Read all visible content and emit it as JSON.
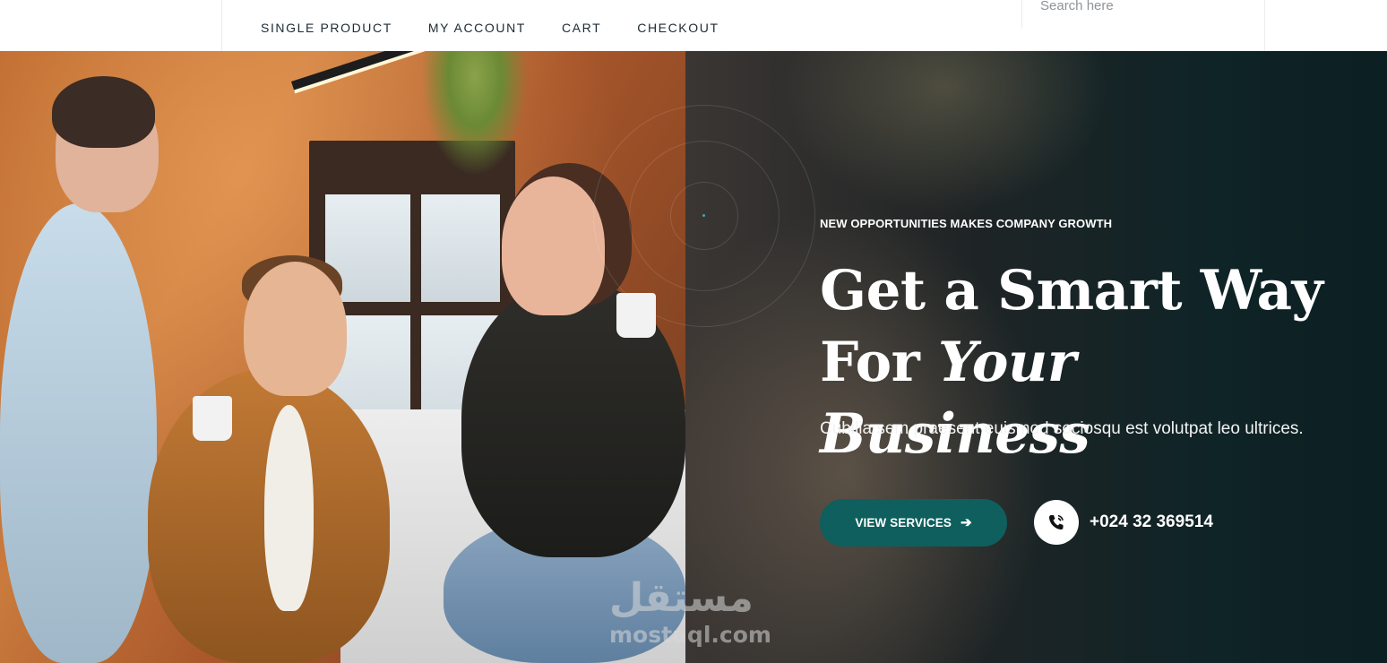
{
  "nav": {
    "items": [
      {
        "label": "SINGLE PRODUCT"
      },
      {
        "label": "MY ACCOUNT"
      },
      {
        "label": "CART"
      },
      {
        "label": "CHECKOUT"
      }
    ]
  },
  "search": {
    "placeholder": "Search here"
  },
  "hero": {
    "tagline": "NEW OPPORTUNITIES MAKES COMPANY GROWTH",
    "headline_line1": "Get a Smart Way",
    "headline_line2_prefix": "For",
    "headline_line2_italic": "Your Business",
    "subtitle": "Cubilia sem praesent euismod sociosqu est volutpat leo ultrices.",
    "cta_label": "VIEW SERVICES",
    "cta_icon": "arrow-right-icon",
    "phone_icon": "phone-icon",
    "phone_number": "+024 32 369514",
    "image_description_icon": "team-photo"
  },
  "watermark": {
    "arabic": "مستقل",
    "latin": "mostaql.com"
  },
  "colors": {
    "accent": "#0e5f5d",
    "dark_panel": "#0f2427",
    "nav_text": "#1b2a33"
  }
}
